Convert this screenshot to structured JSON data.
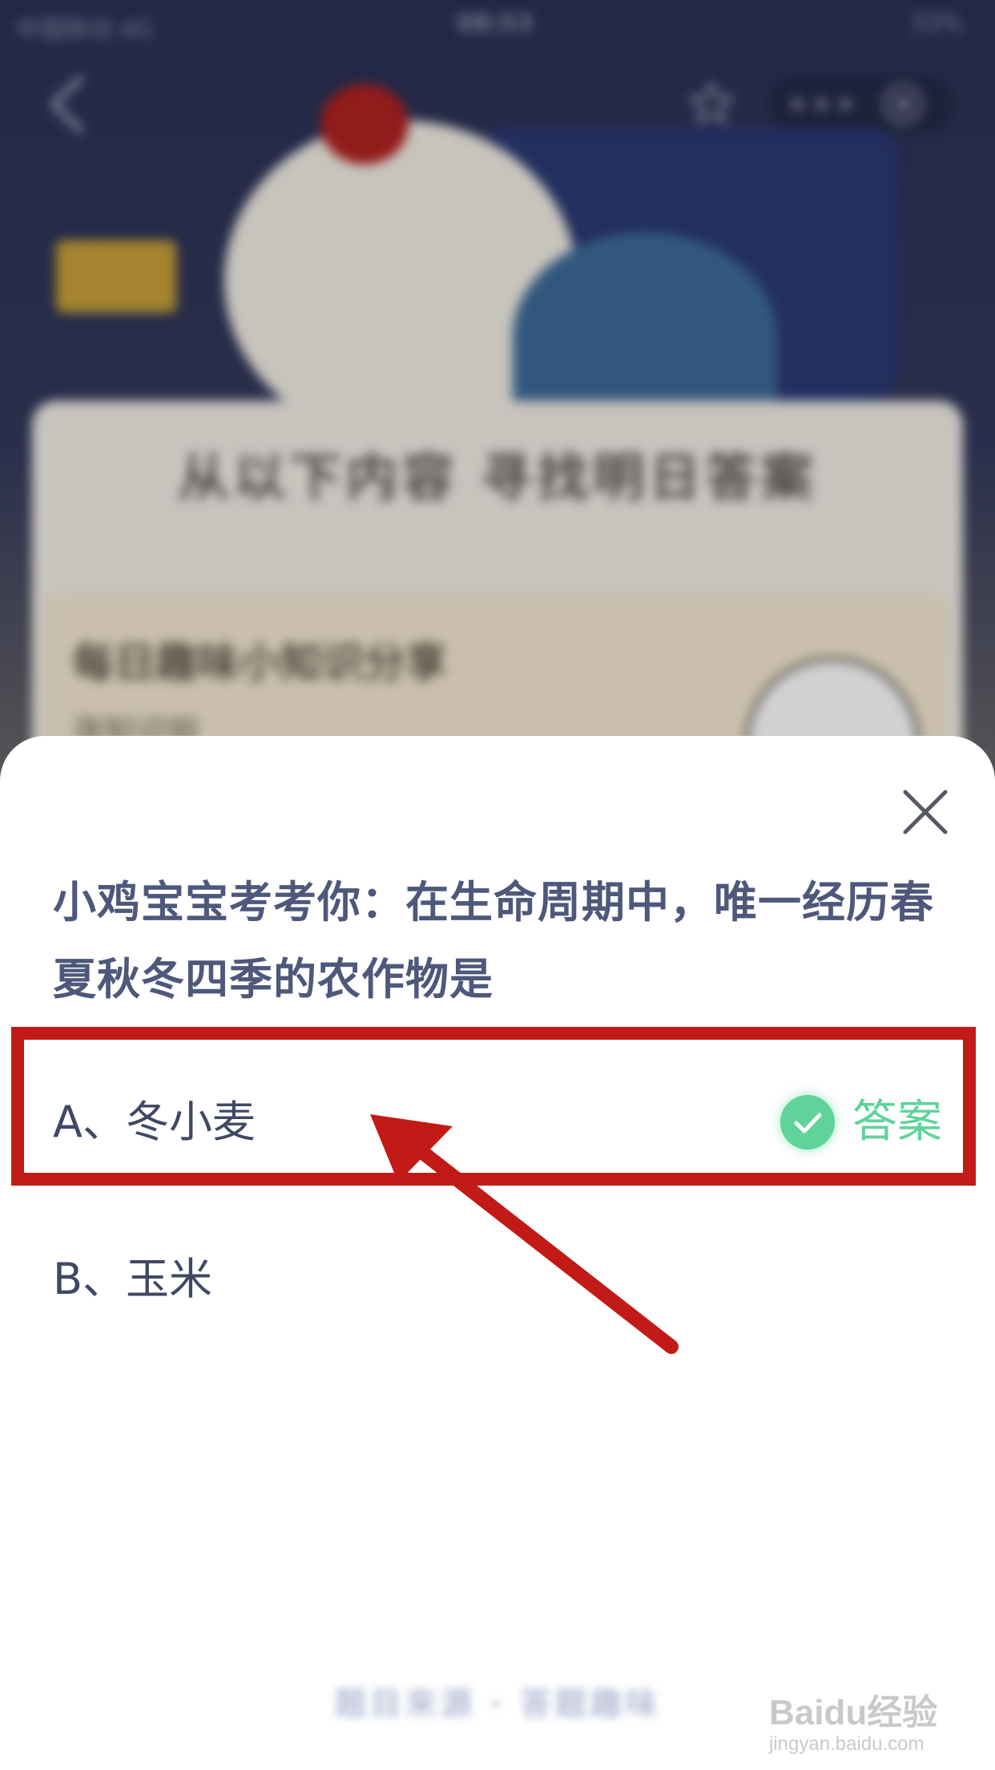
{
  "status_bar": {
    "carrier": "中国移动 4G",
    "time": "08:53",
    "battery": "33%"
  },
  "background": {
    "banner_title": "从以下内容 寻找明日答案",
    "card_title": "每日趣味小知识分享",
    "card_subtitle": "涨知识啦"
  },
  "quiz": {
    "question": "小鸡宝宝考考你：在生命周期中，唯一经历春夏秋冬四季的农作物是",
    "options": [
      {
        "label": "A、冬小麦",
        "is_answer": true
      },
      {
        "label": "B、玉米",
        "is_answer": false
      }
    ],
    "answer_label": "答案",
    "footer_hint": "题目来源 · 答题趣味"
  },
  "watermark": {
    "brand": "Baidu经验",
    "url": "jingyan.baidu.com"
  },
  "colors": {
    "accent_green": "#5fd39a",
    "question_text": "#4e587b",
    "annotation_red": "#c21a17",
    "background_navy": "#2b3156"
  },
  "icons": [
    "back-chevron-icon",
    "star-icon",
    "more-dots-icon",
    "target-icon",
    "close-icon",
    "check-icon"
  ]
}
